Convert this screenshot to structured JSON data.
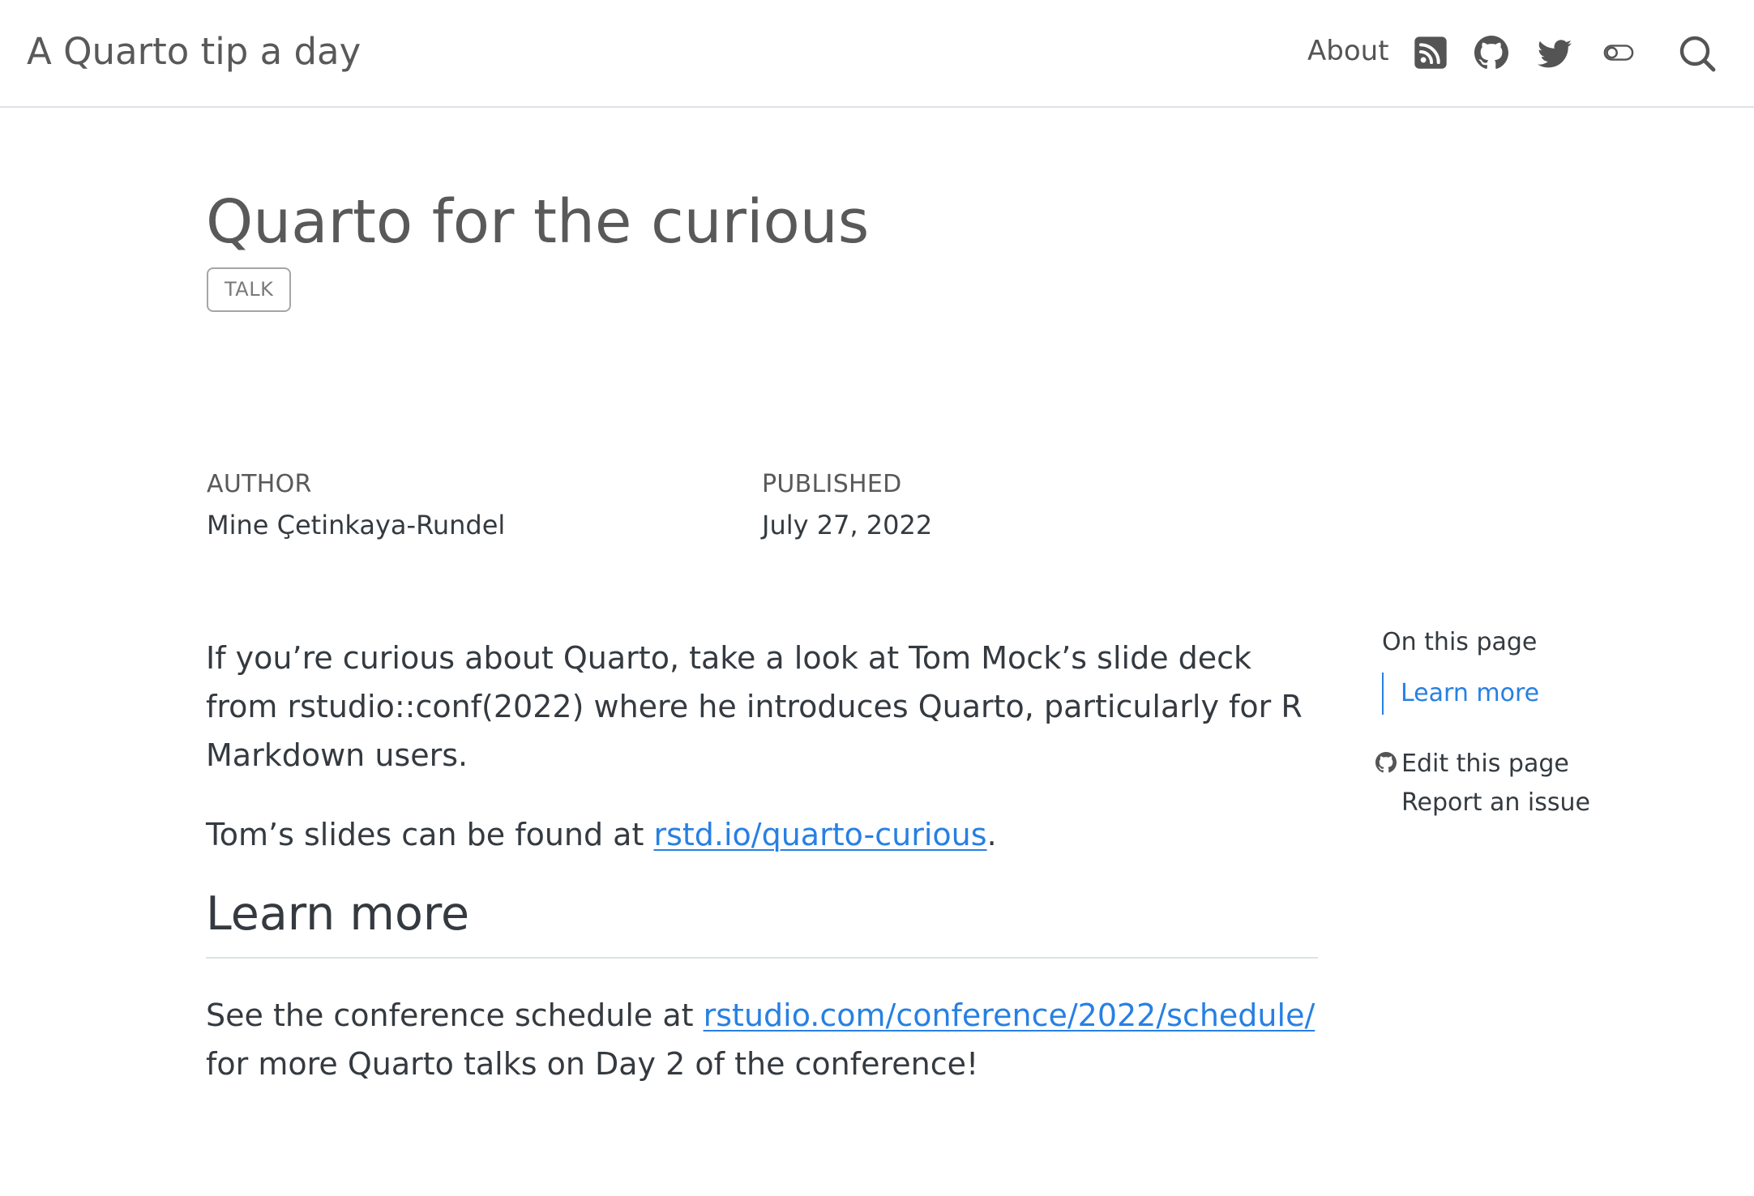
{
  "navbar": {
    "brand": "A Quarto tip a day",
    "about_label": "About",
    "icons": [
      "rss-icon",
      "github-icon",
      "twitter-icon",
      "toggle-icon",
      "search-icon"
    ]
  },
  "post": {
    "title": "Quarto for the curious",
    "category": "TALK",
    "meta": {
      "author_heading": "AUTHOR",
      "author": "Mine Çetinkaya-Rundel",
      "published_heading": "PUBLISHED",
      "published": "July 27, 2022"
    },
    "paragraph1": "If you’re curious about Quarto, take a look at Tom Mock’s slide deck from rstudio::conf(2022) where he introduces Quarto, particularly for R Markdown users.",
    "paragraph2": {
      "before": "Tom’s slides can be found at ",
      "link": "rstd.io/quarto-curious",
      "after": "."
    },
    "section_heading": "Learn more",
    "paragraph3": {
      "before": "See the conference schedule at ",
      "link": "rstudio.com/conference/2022/schedule/",
      "after": " for more Quarto talks on Day 2 of the conference!"
    }
  },
  "toc": {
    "title": "On this page",
    "items": [
      "Learn more"
    ],
    "tools": {
      "edit_label": "Edit this page",
      "issue_label": "Report an issue"
    }
  },
  "colors": {
    "link": "#2780e3",
    "text": "#343a40",
    "muted": "#595959",
    "border": "#dee2e6"
  }
}
